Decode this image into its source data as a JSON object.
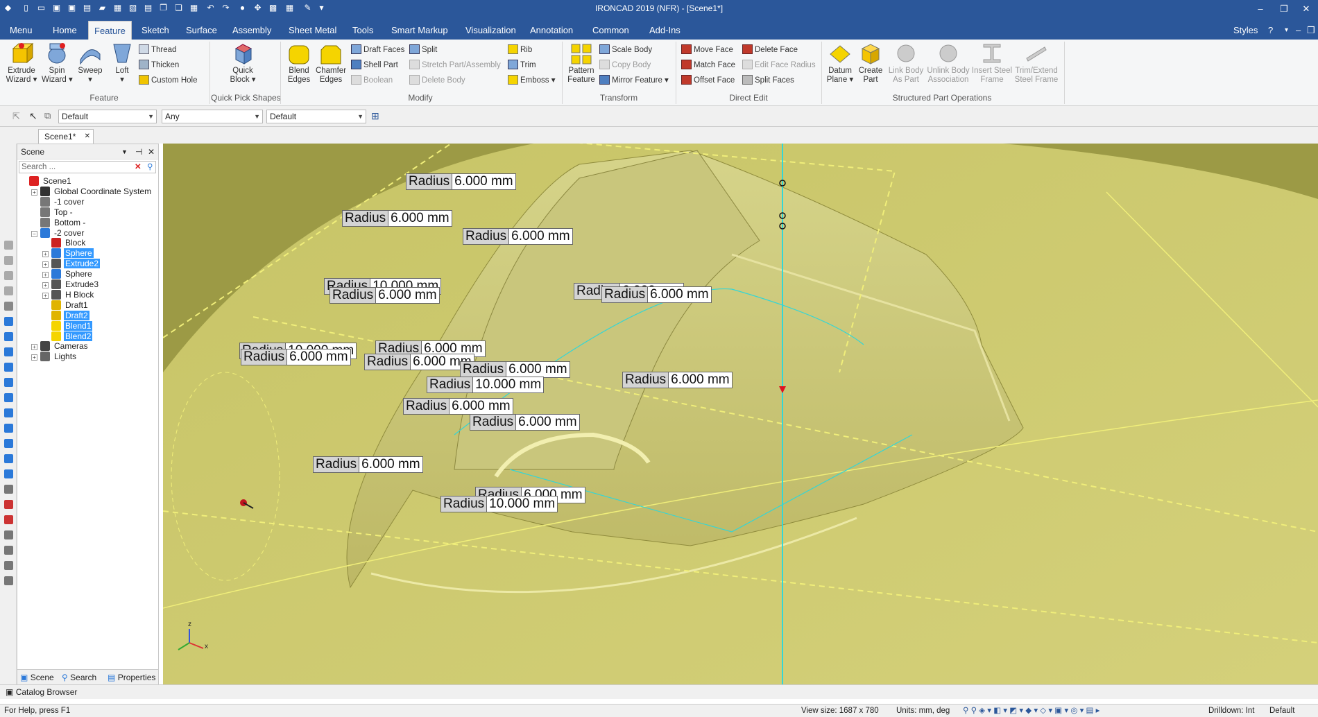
{
  "window": {
    "title": "IRONCAD 2019 (NFR) - [Scene1*]"
  },
  "ribbon_tabs": [
    "Menu",
    "Home",
    "Feature",
    "Sketch",
    "Surface",
    "Assembly",
    "Sheet Metal",
    "Tools",
    "Smart Markup",
    "Visualization",
    "Annotation",
    "Common",
    "Add-Ins"
  ],
  "active_tab": "Feature",
  "styles_label": "Styles",
  "groups": {
    "feature": {
      "label": "Feature",
      "big": [
        {
          "label1": "Extrude",
          "label2": "Wizard"
        },
        {
          "label1": "Spin",
          "label2": "Wizard"
        },
        {
          "label1": "Sweep",
          "label2": ""
        },
        {
          "label1": "Loft",
          "label2": ""
        }
      ],
      "small": [
        "Thread",
        "Thicken",
        "Custom Hole"
      ]
    },
    "quick_pick": {
      "label": "Quick Pick Shapes",
      "big": {
        "label1": "Quick",
        "label2": "Block"
      }
    },
    "modify": {
      "label": "Modify",
      "big": [
        {
          "label1": "Blend",
          "label2": "Edges"
        },
        {
          "label1": "Chamfer",
          "label2": "Edges"
        }
      ],
      "col1": [
        "Draft Faces",
        "Shell Part",
        "Boolean"
      ],
      "col2": [
        "Split",
        "Stretch Part/Assembly",
        "Delete Body"
      ],
      "col3": [
        "Rib",
        "Trim",
        "Emboss"
      ]
    },
    "transform": {
      "label": "Transform",
      "big": {
        "label1": "Pattern",
        "label2": "Feature"
      },
      "small": [
        "Scale Body",
        "Copy Body",
        "Mirror Feature"
      ]
    },
    "direct_edit": {
      "label": "Direct Edit",
      "col1": [
        "Move Face",
        "Match Face",
        "Offset Face"
      ],
      "col2": [
        "Delete Face",
        "Edit Face Radius",
        "Split Faces"
      ]
    },
    "structured": {
      "label": "Structured Part Operations",
      "big": [
        {
          "label1": "Datum",
          "label2": "Plane"
        },
        {
          "label1": "Create",
          "label2": "Part"
        },
        {
          "label1": "Link Body",
          "label2": "As Part"
        },
        {
          "label1": "Unlink Body",
          "label2": "Association"
        },
        {
          "label1": "Insert Steel",
          "label2": "Frame"
        },
        {
          "label1": "Trim/Extend",
          "label2": "Steel Frame"
        }
      ]
    }
  },
  "toolbar": {
    "combo1": "Default",
    "combo2": "Any",
    "combo3": "Default"
  },
  "doc_tab": "Scene1*",
  "scene_panel": {
    "title": "Scene",
    "search_placeholder": "Search ...",
    "tree": [
      {
        "label": "Scene1",
        "level": 0,
        "exp": "",
        "sel": false,
        "icon": "scene"
      },
      {
        "label": "Global Coordinate System",
        "level": 1,
        "exp": "+",
        "sel": false,
        "icon": "axes"
      },
      {
        "label": "-1 cover",
        "level": 1,
        "exp": "",
        "sel": false,
        "icon": "drawing"
      },
      {
        "label": "Top -",
        "level": 1,
        "exp": "",
        "sel": false,
        "icon": "drawing"
      },
      {
        "label": "Bottom -",
        "level": 1,
        "exp": "",
        "sel": false,
        "icon": "drawing"
      },
      {
        "label": "-2 cover",
        "level": 1,
        "exp": "-",
        "sel": false,
        "icon": "part"
      },
      {
        "label": "Block",
        "level": 2,
        "exp": "",
        "sel": false,
        "icon": "block"
      },
      {
        "label": "Sphere",
        "level": 2,
        "exp": "+",
        "sel": true,
        "icon": "sphere"
      },
      {
        "label": "Extrude2",
        "level": 2,
        "exp": "+",
        "sel": true,
        "icon": "extrude"
      },
      {
        "label": "Sphere",
        "level": 2,
        "exp": "+",
        "sel": false,
        "icon": "sphere"
      },
      {
        "label": "Extrude3",
        "level": 2,
        "exp": "+",
        "sel": false,
        "icon": "extrude"
      },
      {
        "label": "H Block",
        "level": 2,
        "exp": "+",
        "sel": false,
        "icon": "extrude"
      },
      {
        "label": "Draft1",
        "level": 2,
        "exp": "",
        "sel": false,
        "icon": "draft"
      },
      {
        "label": "Draft2",
        "level": 2,
        "exp": "",
        "sel": true,
        "icon": "draft"
      },
      {
        "label": "Blend1",
        "level": 2,
        "exp": "",
        "sel": true,
        "icon": "blend"
      },
      {
        "label": "Blend2",
        "level": 2,
        "exp": "",
        "sel": true,
        "icon": "blend"
      },
      {
        "label": "Cameras",
        "level": 1,
        "exp": "+",
        "sel": false,
        "icon": "camera"
      },
      {
        "label": "Lights",
        "level": 1,
        "exp": "+",
        "sel": false,
        "icon": "light"
      }
    ],
    "bottom_tabs": [
      "Scene",
      "Search",
      "Properties"
    ]
  },
  "catalog_browser": "Catalog Browser",
  "status": {
    "help": "For Help, press F1",
    "view_size": "View size: 1687 x  780",
    "units": "Units: mm, deg",
    "drilldown": "Drilldown: Int",
    "default": "Default"
  },
  "radius_key": "Radius",
  "radius_labels": [
    "6.000 mm",
    "6.000 mm",
    "6.000 mm",
    "10.000 mm",
    "6.000 mm",
    "6.000 mm",
    "6.000 mm",
    "10.000 mm",
    "6.000 mm",
    "6.000 mm",
    "6.000 mm",
    "6.000 mm",
    "10.000 mm",
    "6.000 mm",
    "6.000 mm",
    "6.000 mm",
    "6.000 mm",
    "6.000 mm",
    "10.000 mm"
  ],
  "axis_labels": {
    "z": "z",
    "x": "x"
  },
  "colors": {
    "titlebar": "#2b579a",
    "viewport_bg": "#b6b34e",
    "part": "#cfcb74",
    "selection": "#3399ff",
    "axis_line": "#33d6d6"
  }
}
